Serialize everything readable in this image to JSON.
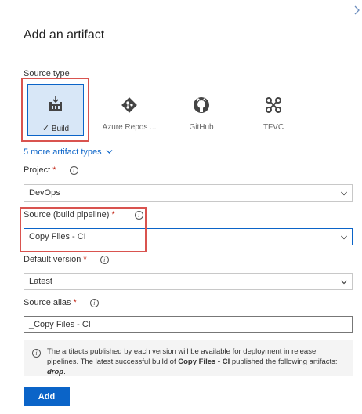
{
  "panel": {
    "title": "Add an artifact",
    "close_icon": "chevron-right-icon",
    "accent_color": "#0b64c8",
    "highlight_color": "#d9534f"
  },
  "source_type": {
    "label": "Source type",
    "tiles": [
      {
        "label": "Build",
        "icon": "build-icon",
        "selected": true,
        "check_mark": "✓"
      },
      {
        "label": "Azure Repos ...",
        "icon": "azure-repos-icon",
        "selected": false
      },
      {
        "label": "GitHub",
        "icon": "github-icon",
        "selected": false
      },
      {
        "label": "TFVC",
        "icon": "tfvc-icon",
        "selected": false
      }
    ],
    "more_link": "5 more artifact types"
  },
  "project": {
    "label": "Project",
    "required_mark": "*",
    "value": "DevOps"
  },
  "source": {
    "label": "Source (build pipeline)",
    "required_mark": "*",
    "value": "Copy Files - CI"
  },
  "default_version": {
    "label": "Default version",
    "required_mark": "*",
    "value": "Latest"
  },
  "source_alias": {
    "label": "Source alias",
    "required_mark": "*",
    "value": "_Copy Files - CI"
  },
  "info": {
    "text_1": "The artifacts published by each version will be available for deployment in release pipelines. The latest successful build of ",
    "bold_name": "Copy Files - CI",
    "text_2": "  published the following artifacts: ",
    "artifact": "drop",
    "text_3": "."
  },
  "add_button": {
    "label": "Add"
  }
}
